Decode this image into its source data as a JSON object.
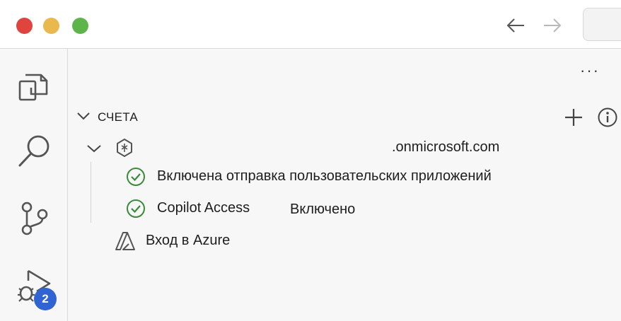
{
  "window": {
    "nav": {
      "back_icon": "arrow-left-icon",
      "forward_icon": "arrow-right-icon"
    }
  },
  "activity_bar": {
    "items": [
      {
        "icon": "explorer-icon"
      },
      {
        "icon": "search-icon"
      },
      {
        "icon": "source-control-icon"
      },
      {
        "icon": "run-debug-icon",
        "badge": "2"
      }
    ]
  },
  "panel": {
    "more_label": "···",
    "section": {
      "title": "СЧЕТА"
    },
    "account": {
      "domain": ".onmicrosoft.com"
    },
    "statuses": [
      {
        "text": "Включена отправка пользовательских приложений"
      },
      {
        "text": "Copilot Access",
        "value": "Включено"
      }
    ],
    "azure": {
      "label": "Вход в Azure"
    }
  },
  "colors": {
    "check": "#3a8a3a",
    "badge": "#2f64d2"
  }
}
